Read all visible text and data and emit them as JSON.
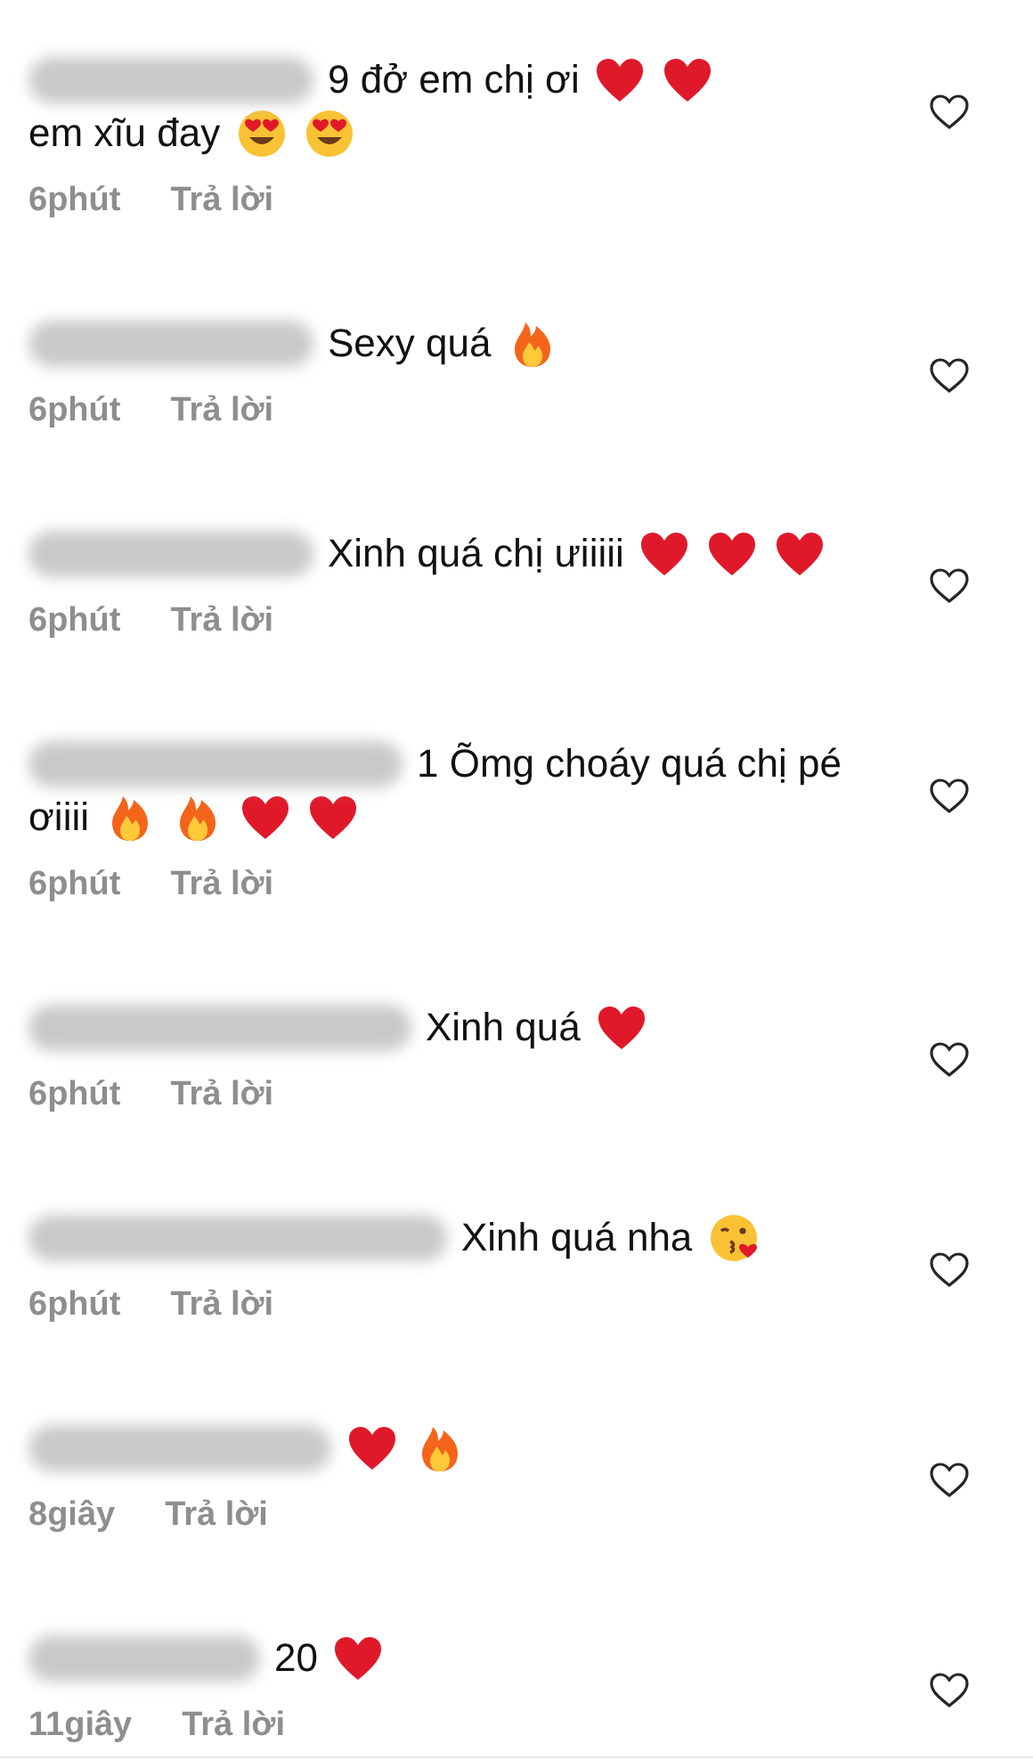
{
  "comments": [
    {
      "parts": [
        {
          "kind": "text",
          "text": "9 đở em chị ơi"
        },
        {
          "kind": "heart"
        },
        {
          "kind": "heart"
        },
        {
          "kind": "text",
          "text": "em xĩu đay"
        },
        {
          "kind": "heart-eyes"
        },
        {
          "kind": "heart-eyes"
        }
      ],
      "time": "6phút",
      "reply": "Trả lời"
    },
    {
      "parts": [
        {
          "kind": "text",
          "text": "Sexy quá"
        },
        {
          "kind": "fire"
        }
      ],
      "time": "6phút",
      "reply": "Trả lời"
    },
    {
      "parts": [
        {
          "kind": "text",
          "text": "Xinh quá chị ưiiiii"
        },
        {
          "kind": "heart"
        },
        {
          "kind": "heart"
        },
        {
          "kind": "heart"
        }
      ],
      "time": "6phút",
      "reply": "Trả lời"
    },
    {
      "parts": [
        {
          "kind": "text",
          "text": "1 Õmg choáy quá chị pé"
        },
        {
          "kind": "text",
          "text": "ơiiii"
        },
        {
          "kind": "fire"
        },
        {
          "kind": "fire"
        },
        {
          "kind": "heart"
        },
        {
          "kind": "heart"
        }
      ],
      "time": "6phút",
      "reply": "Trả lời"
    },
    {
      "parts": [
        {
          "kind": "text",
          "text": "Xinh quá"
        },
        {
          "kind": "heart"
        }
      ],
      "time": "6phút",
      "reply": "Trả lời"
    },
    {
      "parts": [
        {
          "kind": "text",
          "text": "Xinh quá nha"
        },
        {
          "kind": "kiss"
        }
      ],
      "time": "6phút",
      "reply": "Trả lời"
    },
    {
      "parts": [
        {
          "kind": "heart"
        },
        {
          "kind": "fire"
        }
      ],
      "time": "8giây",
      "reply": "Trả lời"
    },
    {
      "parts": [
        {
          "kind": "text",
          "text": "20"
        },
        {
          "kind": "heart"
        }
      ],
      "time": "11giây",
      "reply": "Trả lời"
    }
  ]
}
